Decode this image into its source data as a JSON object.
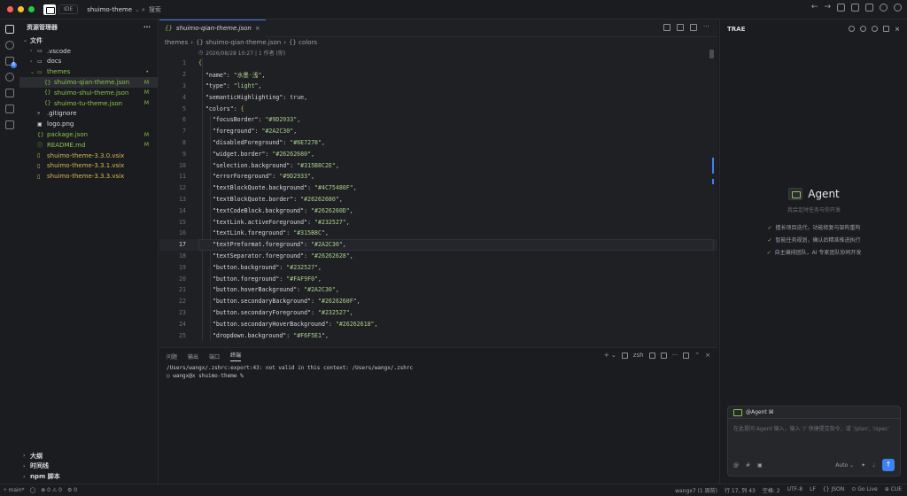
{
  "titlebar": {
    "ide_badge": "IDE",
    "project": "shuimo-theme",
    "search_placeholder": "搜索"
  },
  "sidebar": {
    "title": "资源管理器",
    "more": "···",
    "root": "文件",
    "items": [
      {
        "label": ".vscode",
        "indent": 1,
        "arrow": "›",
        "icon": "▭",
        "color": "gray",
        "status": ""
      },
      {
        "label": "docs",
        "indent": 1,
        "arrow": "›",
        "icon": "▭",
        "color": "gray",
        "status": ""
      },
      {
        "label": "themes",
        "indent": 1,
        "arrow": "⌄",
        "icon": "▭",
        "color": "green",
        "status": "•"
      },
      {
        "label": "shuimo-qian-theme.json",
        "indent": 2,
        "arrow": "",
        "icon": "{}",
        "color": "green",
        "status": "M",
        "selected": true
      },
      {
        "label": "shuimo-shui-theme.json",
        "indent": 2,
        "arrow": "",
        "icon": "{}",
        "color": "green",
        "status": "M"
      },
      {
        "label": "shuimo-tu-theme.json",
        "indent": 2,
        "arrow": "",
        "icon": "{}",
        "color": "green",
        "status": "M"
      },
      {
        "label": ".gitignore",
        "indent": 1,
        "arrow": "",
        "icon": "⑂",
        "color": "gray",
        "status": ""
      },
      {
        "label": "logo.png",
        "indent": 1,
        "arrow": "",
        "icon": "▣",
        "color": "gray",
        "status": ""
      },
      {
        "label": "package.json",
        "indent": 1,
        "arrow": "",
        "icon": "{}",
        "color": "green",
        "status": "M"
      },
      {
        "label": "README.md",
        "indent": 1,
        "arrow": "",
        "icon": "ⓘ",
        "color": "green",
        "status": "M"
      },
      {
        "label": "shuimo-theme-3.3.0.vsix",
        "indent": 1,
        "arrow": "",
        "icon": "▯",
        "color": "yellow",
        "status": ""
      },
      {
        "label": "shuimo-theme-3.3.1.vsix",
        "indent": 1,
        "arrow": "",
        "icon": "▯",
        "color": "yellow",
        "status": ""
      },
      {
        "label": "shuimo-theme-3.3.3.vsix",
        "indent": 1,
        "arrow": "",
        "icon": "▯",
        "color": "yellow",
        "status": ""
      }
    ],
    "footer": [
      "大纲",
      "时间线",
      "npm 脚本"
    ]
  },
  "editor": {
    "tab_label": "shuimo-qian-theme.json",
    "tab_close": "×",
    "breadcrumb": [
      "themes",
      "{} shuimo-qian-theme.json",
      "{} colors"
    ],
    "blame": "2026/08/28 10:27 | 1 作者 (你)",
    "current_line": 17,
    "lines": [
      {
        "n": "1",
        "t": "{"
      },
      {
        "n": "2",
        "t": "  \"name\": \"水墨·浅\","
      },
      {
        "n": "3",
        "t": "  \"type\": \"light\","
      },
      {
        "n": "4",
        "t": "  \"semanticHighlighting\": true,"
      },
      {
        "n": "5",
        "t": "  \"colors\": {"
      },
      {
        "n": "6",
        "t": "    \"focusBorder\": \"#9D2933\","
      },
      {
        "n": "7",
        "t": "    \"foreground\": \"#2A2C30\","
      },
      {
        "n": "8",
        "t": "    \"disabledForeground\": \"#6E7278\","
      },
      {
        "n": "9",
        "t": "    \"widget.border\": \"#26262680\","
      },
      {
        "n": "10",
        "t": "    \"selection.background\": \"#315B8C2E\","
      },
      {
        "n": "11",
        "t": "    \"errorForeground\": \"#9D2933\","
      },
      {
        "n": "12",
        "t": "    \"textBlockQuote.background\": \"#4C75480F\","
      },
      {
        "n": "13",
        "t": "    \"textBlockQuote.border\": \"#26262680\","
      },
      {
        "n": "14",
        "t": "    \"textCodeBlock.background\": \"#2626260D\","
      },
      {
        "n": "15",
        "t": "    \"textLink.activeForeground\": \"#232527\","
      },
      {
        "n": "16",
        "t": "    \"textLink.foreground\": \"#315B8C\","
      },
      {
        "n": "17",
        "t": "    \"textPreformat.foreground\": \"#2A2C30\","
      },
      {
        "n": "18",
        "t": "    \"textSeparator.foreground\": \"#26262628\","
      },
      {
        "n": "19",
        "t": "    \"button.background\": \"#232527\","
      },
      {
        "n": "20",
        "t": "    \"button.foreground\": \"#FAF9F0\","
      },
      {
        "n": "21",
        "t": "    \"button.hoverBackground\": \"#2A2C30\","
      },
      {
        "n": "22",
        "t": "    \"button.secondaryBackground\": \"#2626260F\","
      },
      {
        "n": "23",
        "t": "    \"button.secondaryForeground\": \"#232527\","
      },
      {
        "n": "24",
        "t": "    \"button.secondaryHoverBackground\": \"#26262618\","
      },
      {
        "n": "25",
        "t": "    \"dropdown.background\": \"#F6F5E1\","
      }
    ]
  },
  "panel": {
    "tabs": [
      "问题",
      "输出",
      "端口",
      "终端"
    ],
    "active_tab": "终端",
    "shell": "zsh",
    "terminal_lines": [
      "/Users/wangx/.zshrc:export:43: not valid in this context: /Users/wangx/.zshrc",
      "○ wangx@x shuimo-theme %"
    ]
  },
  "right": {
    "title": "TRAE",
    "agent_title": "Agent",
    "agent_sub": "我会定时任务与你开发",
    "features": [
      "擅长项目迭代，功能修复与架构重构",
      "智能任务规划，确认后精准推进执行",
      "自主编排团队，AI 专家团队协同开发"
    ],
    "chat_tag": "@Agent ⌘",
    "chat_placeholder": "在此提问 Agent 输入，输入 '/' 快捷提交指令，或 '/plan', '/spec'",
    "mode": "Auto ⌄",
    "send": "↑"
  },
  "status": {
    "left": [
      "⑂ main*",
      "◯",
      "⊗ 0 ⚠ 0",
      "⚙ 0"
    ],
    "right": [
      "wangx7 (1 周前)",
      "行 17, 列 43",
      "空格: 2",
      "UTF-8",
      "LF",
      "{} JSON",
      "⊙ Go Live",
      "⊕ CUE"
    ]
  }
}
